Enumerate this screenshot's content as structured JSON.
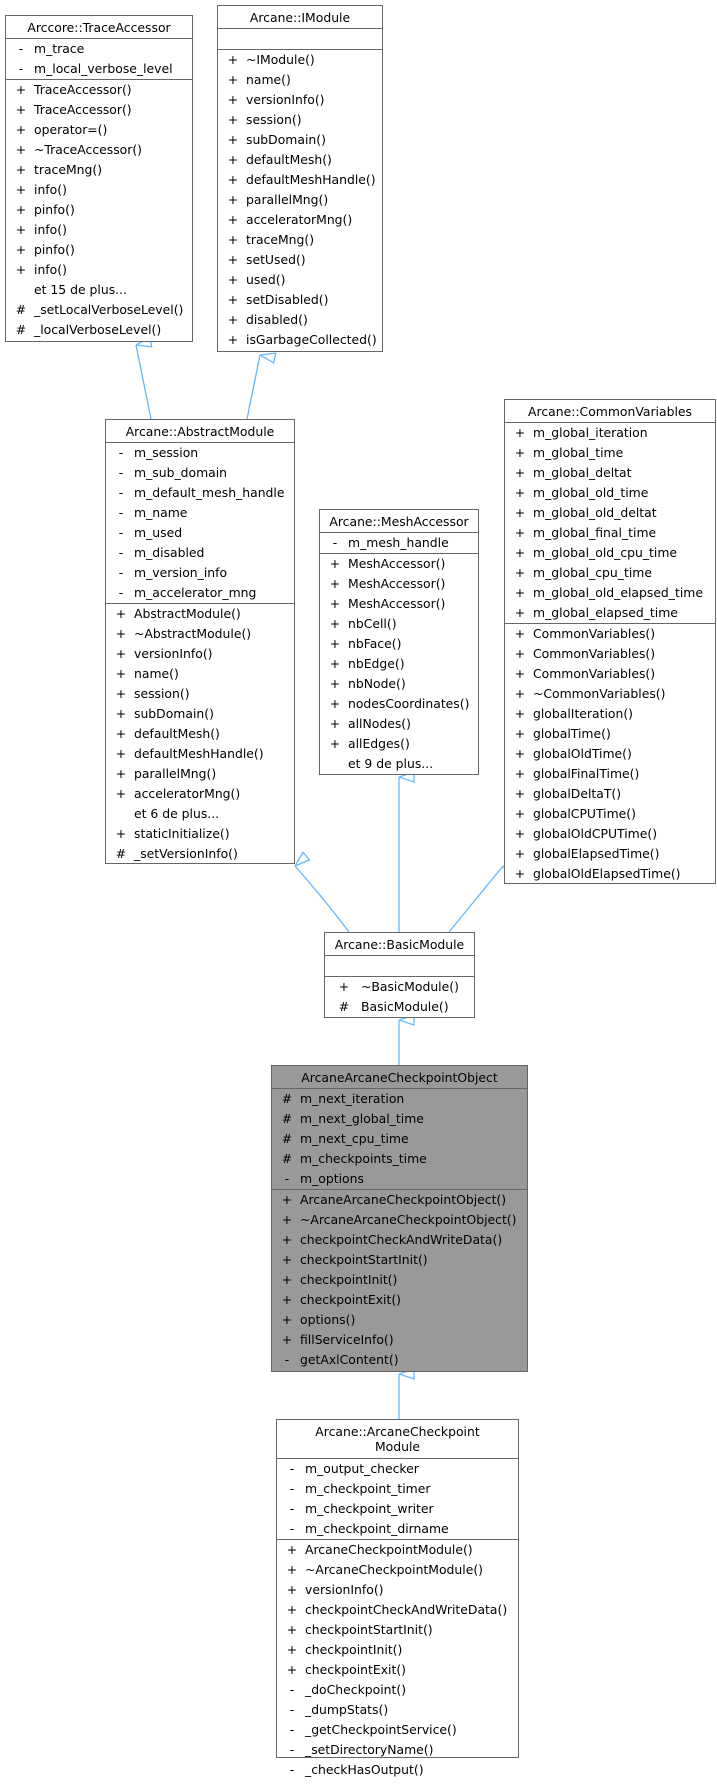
{
  "edge_color": "#63b8ff",
  "focus_fill": "#999999",
  "classes": {
    "trace_accessor": {
      "name": "Arccore::TraceAccessor",
      "attributes": [
        {
          "vis": "-",
          "name": "m_trace"
        },
        {
          "vis": "-",
          "name": "m_local_verbose_level"
        }
      ],
      "methods": [
        {
          "vis": "+",
          "name": "TraceAccessor()"
        },
        {
          "vis": "+",
          "name": "TraceAccessor()"
        },
        {
          "vis": "+",
          "name": "operator=()"
        },
        {
          "vis": "+",
          "name": "~TraceAccessor()"
        },
        {
          "vis": "+",
          "name": "traceMng()"
        },
        {
          "vis": "+",
          "name": "info()"
        },
        {
          "vis": "+",
          "name": "pinfo()"
        },
        {
          "vis": "+",
          "name": "info()"
        },
        {
          "vis": "+",
          "name": "pinfo()"
        },
        {
          "vis": "+",
          "name": "info()"
        },
        {
          "vis": "",
          "name": "et 15 de plus..."
        },
        {
          "vis": "#",
          "name": "_setLocalVerboseLevel()"
        },
        {
          "vis": "#",
          "name": "_localVerboseLevel()"
        }
      ]
    },
    "imodule": {
      "name": "Arcane::IModule",
      "attributes": [],
      "methods": [
        {
          "vis": "+",
          "name": "~IModule()"
        },
        {
          "vis": "+",
          "name": "name()"
        },
        {
          "vis": "+",
          "name": "versionInfo()"
        },
        {
          "vis": "+",
          "name": "session()"
        },
        {
          "vis": "+",
          "name": "subDomain()"
        },
        {
          "vis": "+",
          "name": "defaultMesh()"
        },
        {
          "vis": "+",
          "name": "defaultMeshHandle()"
        },
        {
          "vis": "+",
          "name": "parallelMng()"
        },
        {
          "vis": "+",
          "name": "acceleratorMng()"
        },
        {
          "vis": "+",
          "name": "traceMng()"
        },
        {
          "vis": "+",
          "name": "setUsed()"
        },
        {
          "vis": "+",
          "name": "used()"
        },
        {
          "vis": "+",
          "name": "setDisabled()"
        },
        {
          "vis": "+",
          "name": "disabled()"
        },
        {
          "vis": "+",
          "name": "isGarbageCollected()"
        }
      ]
    },
    "abstract_module": {
      "name": "Arcane::AbstractModule",
      "attributes": [
        {
          "vis": "-",
          "name": "m_session"
        },
        {
          "vis": "-",
          "name": "m_sub_domain"
        },
        {
          "vis": "-",
          "name": "m_default_mesh_handle"
        },
        {
          "vis": "-",
          "name": "m_name"
        },
        {
          "vis": "-",
          "name": "m_used"
        },
        {
          "vis": "-",
          "name": "m_disabled"
        },
        {
          "vis": "-",
          "name": "m_version_info"
        },
        {
          "vis": "-",
          "name": "m_accelerator_mng"
        }
      ],
      "methods": [
        {
          "vis": "+",
          "name": "AbstractModule()"
        },
        {
          "vis": "+",
          "name": "~AbstractModule()"
        },
        {
          "vis": "+",
          "name": "versionInfo()"
        },
        {
          "vis": "+",
          "name": "name()"
        },
        {
          "vis": "+",
          "name": "session()"
        },
        {
          "vis": "+",
          "name": "subDomain()"
        },
        {
          "vis": "+",
          "name": "defaultMesh()"
        },
        {
          "vis": "+",
          "name": "defaultMeshHandle()"
        },
        {
          "vis": "+",
          "name": "parallelMng()"
        },
        {
          "vis": "+",
          "name": "acceleratorMng()"
        },
        {
          "vis": "",
          "name": "et 6 de plus..."
        },
        {
          "vis": "+",
          "name": "staticInitialize()"
        },
        {
          "vis": "#",
          "name": "_setVersionInfo()"
        }
      ]
    },
    "mesh_accessor": {
      "name": "Arcane::MeshAccessor",
      "attributes": [
        {
          "vis": "-",
          "name": "m_mesh_handle"
        }
      ],
      "methods": [
        {
          "vis": "+",
          "name": "MeshAccessor()"
        },
        {
          "vis": "+",
          "name": "MeshAccessor()"
        },
        {
          "vis": "+",
          "name": "MeshAccessor()"
        },
        {
          "vis": "+",
          "name": "nbCell()"
        },
        {
          "vis": "+",
          "name": "nbFace()"
        },
        {
          "vis": "+",
          "name": "nbEdge()"
        },
        {
          "vis": "+",
          "name": "nbNode()"
        },
        {
          "vis": "+",
          "name": "nodesCoordinates()"
        },
        {
          "vis": "+",
          "name": "allNodes()"
        },
        {
          "vis": "+",
          "name": "allEdges()"
        },
        {
          "vis": "",
          "name": "et 9 de plus..."
        }
      ]
    },
    "common_variables": {
      "name": "Arcane::CommonVariables",
      "attributes": [
        {
          "vis": "+",
          "name": "m_global_iteration"
        },
        {
          "vis": "+",
          "name": "m_global_time"
        },
        {
          "vis": "+",
          "name": "m_global_deltat"
        },
        {
          "vis": "+",
          "name": "m_global_old_time"
        },
        {
          "vis": "+",
          "name": "m_global_old_deltat"
        },
        {
          "vis": "+",
          "name": "m_global_final_time"
        },
        {
          "vis": "+",
          "name": "m_global_old_cpu_time"
        },
        {
          "vis": "+",
          "name": "m_global_cpu_time"
        },
        {
          "vis": "+",
          "name": "m_global_old_elapsed_time"
        },
        {
          "vis": "+",
          "name": "m_global_elapsed_time"
        }
      ],
      "methods": [
        {
          "vis": "+",
          "name": "CommonVariables()"
        },
        {
          "vis": "+",
          "name": "CommonVariables()"
        },
        {
          "vis": "+",
          "name": "CommonVariables()"
        },
        {
          "vis": "+",
          "name": "~CommonVariables()"
        },
        {
          "vis": "+",
          "name": "globalIteration()"
        },
        {
          "vis": "+",
          "name": "globalTime()"
        },
        {
          "vis": "+",
          "name": "globalOldTime()"
        },
        {
          "vis": "+",
          "name": "globalFinalTime()"
        },
        {
          "vis": "+",
          "name": "globalDeltaT()"
        },
        {
          "vis": "+",
          "name": "globalCPUTime()"
        },
        {
          "vis": "+",
          "name": "globalOldCPUTime()"
        },
        {
          "vis": "+",
          "name": "globalElapsedTime()"
        },
        {
          "vis": "+",
          "name": "globalOldElapsedTime()"
        }
      ]
    },
    "basic_module": {
      "name": "Arcane::BasicModule",
      "attributes": [],
      "methods": [
        {
          "vis": "+",
          "name": "~BasicModule()"
        },
        {
          "vis": "#",
          "name": "BasicModule()"
        }
      ]
    },
    "checkpoint_object": {
      "name": "ArcaneArcaneCheckpointObject",
      "attributes": [
        {
          "vis": "#",
          "name": "m_next_iteration"
        },
        {
          "vis": "#",
          "name": "m_next_global_time"
        },
        {
          "vis": "#",
          "name": "m_next_cpu_time"
        },
        {
          "vis": "#",
          "name": "m_checkpoints_time"
        },
        {
          "vis": "-",
          "name": "m_options"
        }
      ],
      "methods": [
        {
          "vis": "+",
          "name": "ArcaneArcaneCheckpointObject()"
        },
        {
          "vis": "+",
          "name": "~ArcaneArcaneCheckpointObject()"
        },
        {
          "vis": "+",
          "name": "checkpointCheckAndWriteData()"
        },
        {
          "vis": "+",
          "name": "checkpointStartInit()"
        },
        {
          "vis": "+",
          "name": "checkpointInit()"
        },
        {
          "vis": "+",
          "name": "checkpointExit()"
        },
        {
          "vis": "+",
          "name": "options()"
        },
        {
          "vis": "+",
          "name": "fillServiceInfo()"
        },
        {
          "vis": "-",
          "name": "getAxlContent()"
        }
      ]
    },
    "checkpoint_module": {
      "name_line1": "Arcane::ArcaneCheckpoint",
      "name_line2": "Module",
      "attributes": [
        {
          "vis": "-",
          "name": "m_output_checker"
        },
        {
          "vis": "-",
          "name": "m_checkpoint_timer"
        },
        {
          "vis": "-",
          "name": "m_checkpoint_writer"
        },
        {
          "vis": "-",
          "name": "m_checkpoint_dirname"
        }
      ],
      "methods": [
        {
          "vis": "+",
          "name": "ArcaneCheckpointModule()"
        },
        {
          "vis": "+",
          "name": "~ArcaneCheckpointModule()"
        },
        {
          "vis": "+",
          "name": "versionInfo()"
        },
        {
          "vis": "+",
          "name": "checkpointCheckAndWriteData()"
        },
        {
          "vis": "+",
          "name": "checkpointStartInit()"
        },
        {
          "vis": "+",
          "name": "checkpointInit()"
        },
        {
          "vis": "+",
          "name": "checkpointExit()"
        },
        {
          "vis": "-",
          "name": "_doCheckpoint()"
        },
        {
          "vis": "-",
          "name": "_dumpStats()"
        },
        {
          "vis": "-",
          "name": "_getCheckpointService()"
        },
        {
          "vis": "-",
          "name": "_setDirectoryName()"
        },
        {
          "vis": "-",
          "name": "_checkHasOutput()"
        }
      ]
    }
  },
  "inheritance": [
    {
      "from": "abstract_module",
      "to": "trace_accessor"
    },
    {
      "from": "abstract_module",
      "to": "imodule"
    },
    {
      "from": "basic_module",
      "to": "abstract_module"
    },
    {
      "from": "basic_module",
      "to": "mesh_accessor"
    },
    {
      "from": "basic_module",
      "to": "common_variables"
    },
    {
      "from": "checkpoint_object",
      "to": "basic_module"
    },
    {
      "from": "checkpoint_module",
      "to": "checkpoint_object"
    }
  ]
}
